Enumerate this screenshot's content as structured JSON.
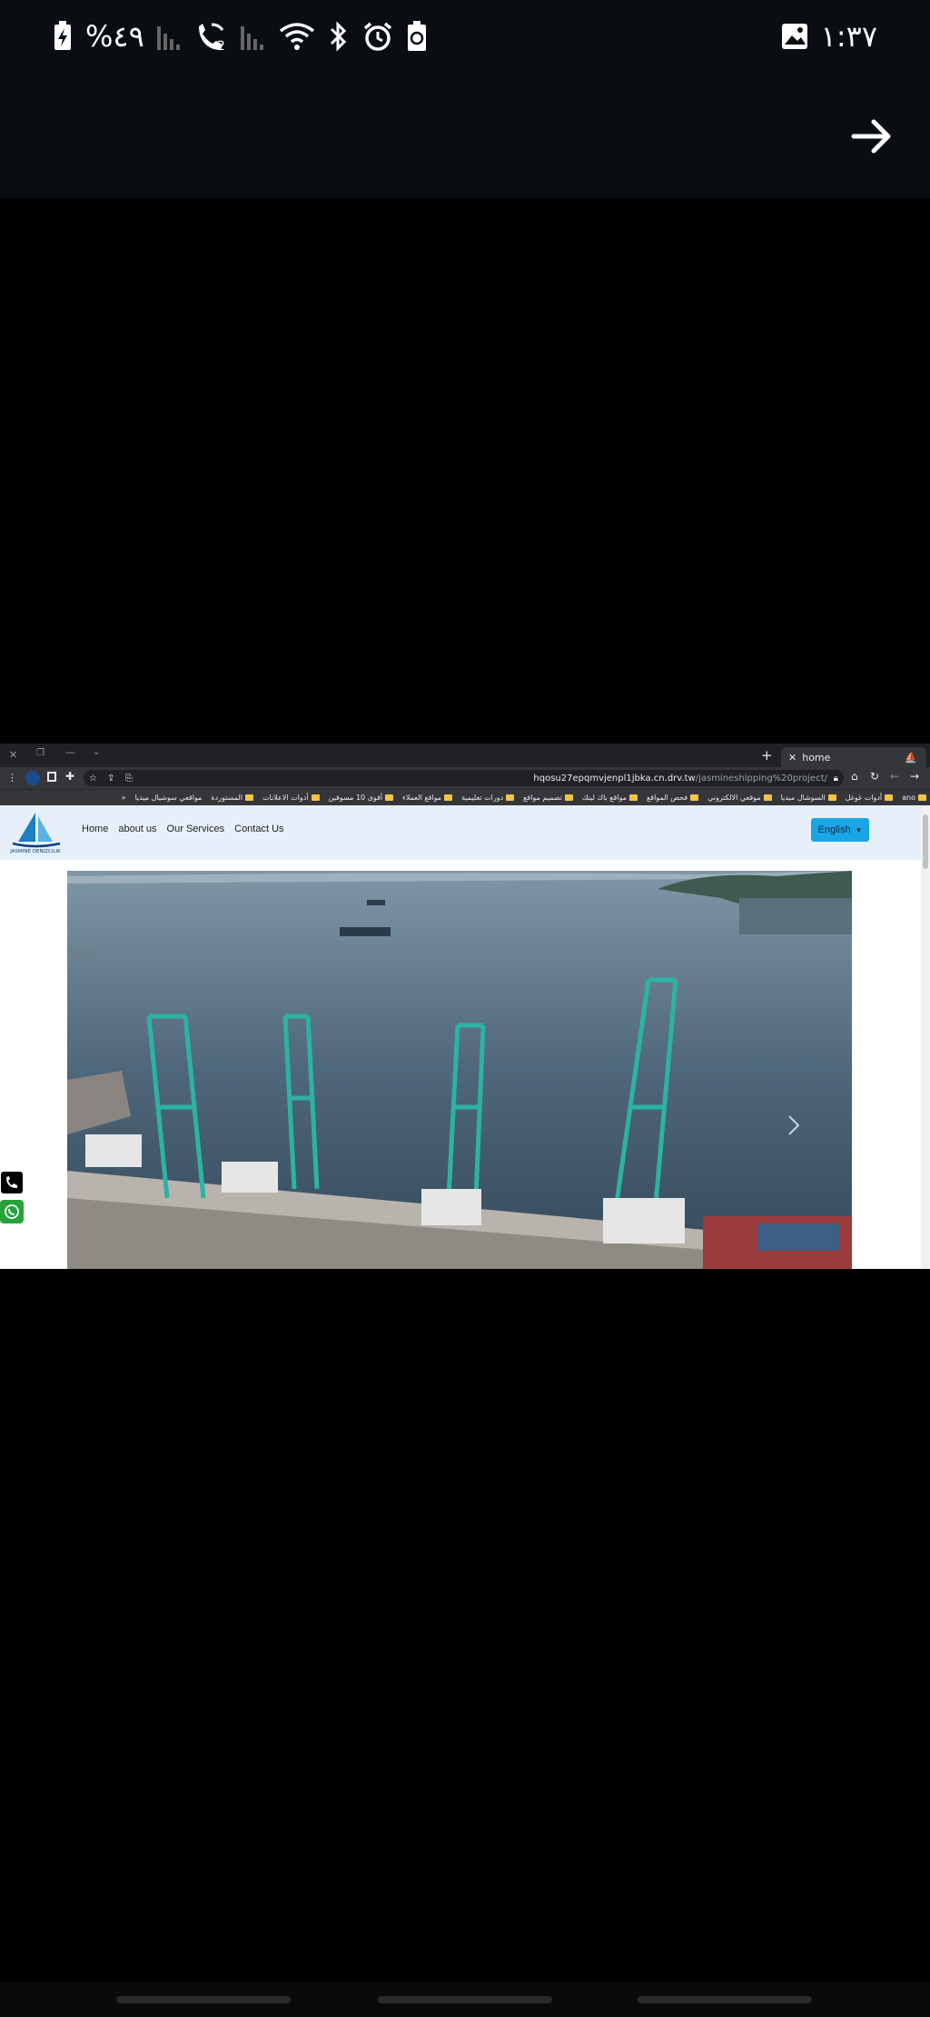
{
  "status_bar": {
    "battery_percent": "%٤٩",
    "time": "١:٣٧",
    "icons": [
      "battery-charging-icon",
      "signal-icon",
      "wifi-call-icon",
      "signal-icon",
      "wifi-icon",
      "bluetooth-icon",
      "alarm-icon",
      "battery-saver-icon",
      "gallery-icon"
    ]
  },
  "browser": {
    "tab_title": "home",
    "url_host": "hqosu27epqmvjenpl1jbka.cn.drv.tw",
    "url_path": "/jasmineshipping%20project/",
    "bookmarks": [
      "ano",
      "أدوات غوغل",
      "السوشال ميديا",
      "موقعي الالكتروني",
      "فحص المواقع",
      "مواقع باك لينك",
      "تصميم مواقع",
      "دورات تعليمية",
      "مواقع العملاء",
      "أقوى 10 مسوقين",
      "أدوات الاعلانات",
      "المستوردة",
      "مواقعي سوشيال ميديا"
    ]
  },
  "site": {
    "nav": [
      "Home",
      "about us",
      "Our Services",
      "Contact Us"
    ],
    "language": "English",
    "logo_text": "JASMINE DENIZCILIK"
  },
  "colors": {
    "header_bg": "#e7f0fa",
    "accent": "#1aa6e6",
    "whatsapp": "#25a33a"
  }
}
